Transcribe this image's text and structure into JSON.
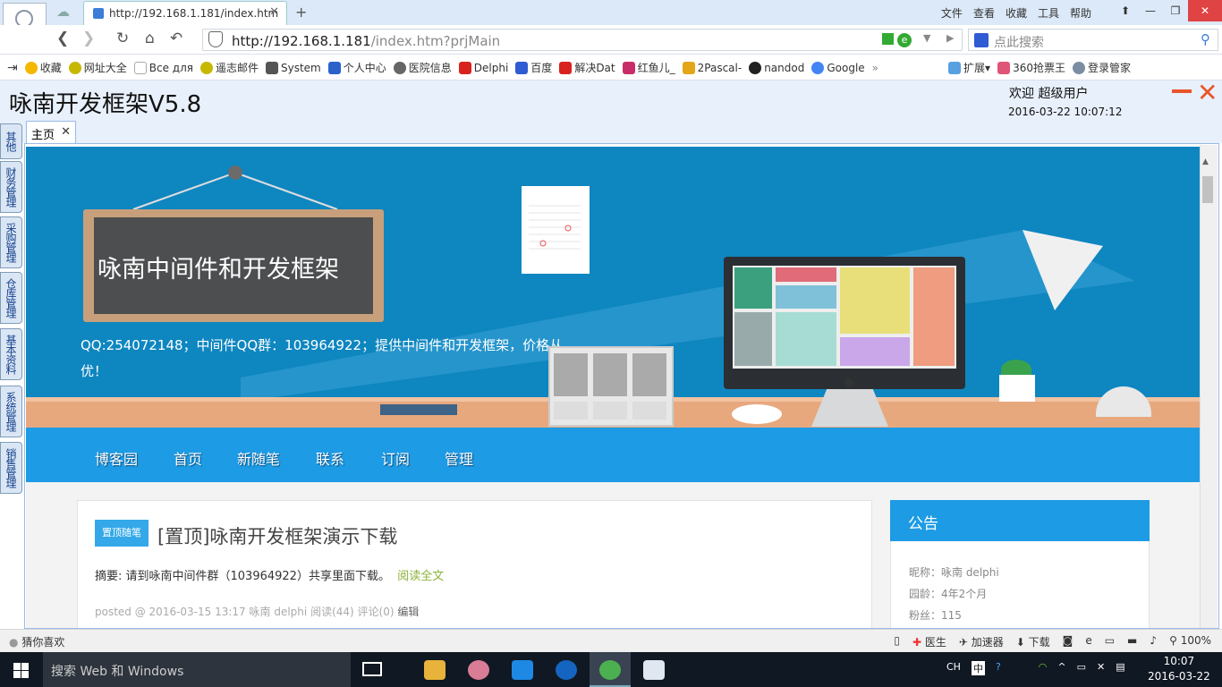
{
  "browser": {
    "tab_title": "http://192.168.1.181/index.htm",
    "new_tab": "+",
    "menus": [
      "文件",
      "查看",
      "收藏",
      "工具",
      "帮助"
    ],
    "url_host": "http://192.168.1.181",
    "url_path": "/index.htm?prjMain",
    "search_placeholder": "点此搜索",
    "bookmarks": [
      {
        "label": "收藏",
        "color": "#f5b800"
      },
      {
        "label": "网址大全",
        "color": "#f5b800"
      },
      {
        "label": "Все для",
        "color": "#ffffff"
      },
      {
        "label": "遥志邮件",
        "color": "#c6b800"
      },
      {
        "label": "System",
        "color": "#333333"
      },
      {
        "label": "个人中心",
        "color": "#2a62c9"
      },
      {
        "label": "医院信息",
        "color": "#666666"
      },
      {
        "label": "Delphi",
        "color": "#d8221d"
      },
      {
        "label": "百度",
        "color": "#2f5bd3"
      },
      {
        "label": "解决Dat",
        "color": "#d8221d"
      },
      {
        "label": "红鱼儿_",
        "color": "#c82d6a"
      },
      {
        "label": "2Pascal-",
        "color": "#e3a618"
      },
      {
        "label": "nandod",
        "color": "#222222"
      },
      {
        "label": "Google",
        "color": "#4285f4"
      }
    ],
    "bookmarks_right": [
      {
        "label": "扩展",
        "color": "#5aa0e0"
      },
      {
        "label": "360抢票王",
        "color": "#e05577"
      },
      {
        "label": "登录管家",
        "color": "#7a8da3"
      }
    ]
  },
  "app": {
    "title": "咏南开发框架V5.8",
    "welcome": "欢迎 超级用户",
    "datetime": "2016-03-22 10:07:12",
    "side_tabs": [
      "其他",
      "财务管理",
      "采购管理",
      "仓库管理",
      "基本资料",
      "系统管理",
      "销售管理"
    ],
    "page_tab": "主页"
  },
  "blog": {
    "board_text": "咏南中间件和开发框架",
    "qq_text": "QQ:254072148；中间件QQ群：103964922；提供中间件和开发框架，价格从优！",
    "nav": [
      "博客园",
      "首页",
      "新随笔",
      "联系",
      "订阅",
      "管理"
    ],
    "post": {
      "badge": "置顶随笔",
      "title": "[置顶]咏南开发框架演示下载",
      "summary": "摘要: 请到咏南中间件群（103964922）共享里面下载。",
      "read_more": "阅读全文",
      "meta": "posted @ 2016-03-15 13:17",
      "author": "咏南 delphi",
      "stats": "阅读(44) 评论(0)",
      "edit": "编辑"
    },
    "notice": {
      "heading": "公告",
      "lines": [
        "昵称：咏南 delphi",
        "园龄：4年2个月",
        "粉丝：115"
      ]
    }
  },
  "statusbar": {
    "left": "猜你喜欢",
    "right": [
      "医生",
      "加速器",
      "下载",
      "100%"
    ]
  },
  "taskbar": {
    "search": "搜索 Web 和 Windows",
    "tray_lang": "CH",
    "time": "10:07",
    "date": "2016-03-22"
  }
}
